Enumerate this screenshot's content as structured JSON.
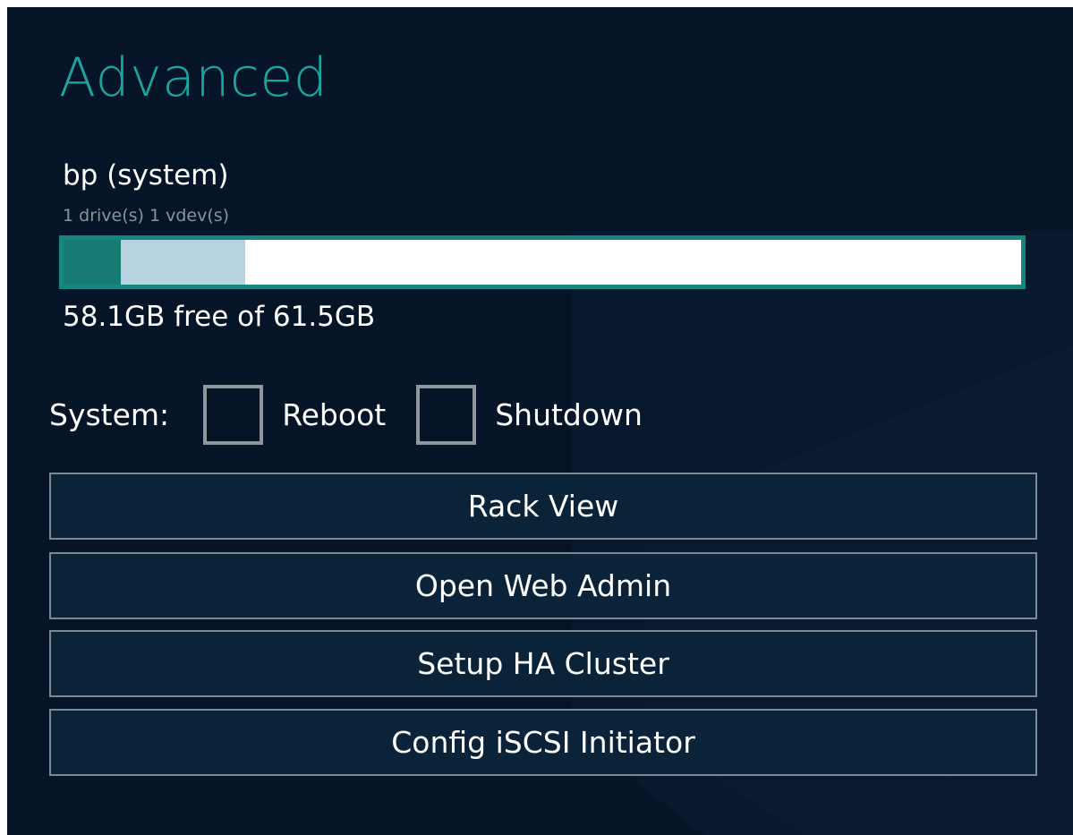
{
  "page": {
    "title": "Advanced"
  },
  "pool": {
    "name": "bp (system)",
    "details": "1 drive(s) 1 vdev(s)",
    "usage_text": "58.1GB free of 61.5GB",
    "used_fraction": 0.06,
    "reserved_fraction": 0.13
  },
  "system": {
    "label": "System:",
    "options": [
      {
        "label": "Reboot",
        "checked": false
      },
      {
        "label": "Shutdown",
        "checked": false
      }
    ]
  },
  "buttons": [
    {
      "label": "Rack View"
    },
    {
      "label": "Open Web Admin"
    },
    {
      "label": "Setup HA Cluster"
    },
    {
      "label": "Config iSCSI Initiator"
    }
  ],
  "colors": {
    "background": "#051426",
    "accent": "#1aa6a0",
    "bar_border": "#168681",
    "bar_used": "#177b73",
    "bar_reserved": "#b7d3e0",
    "button_bg": "#0b2339",
    "button_border": "#7f8891"
  }
}
